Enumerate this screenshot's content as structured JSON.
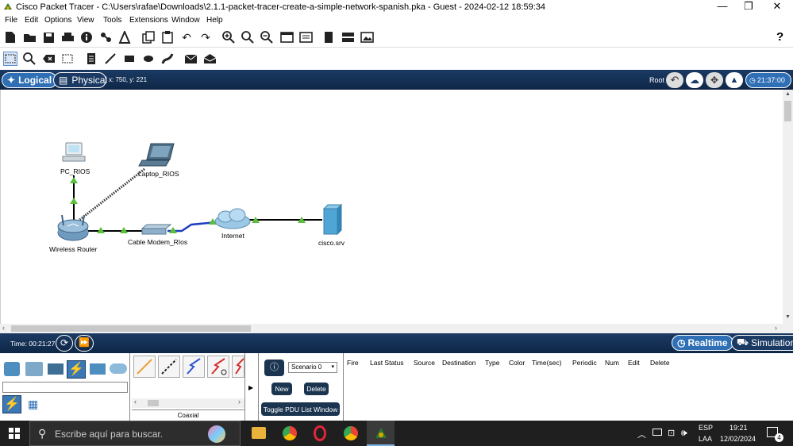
{
  "window": {
    "title": "Cisco Packet Tracer - C:\\Users\\rafae\\Downloads\\2.1.1-packet-tracer-create-a-simple-network-spanish.pka - Guest - 2024-02-12 18:59:34",
    "minimize": "—",
    "restore": "❐",
    "close": "✕"
  },
  "menu": [
    "File",
    "Edit",
    "Options",
    "View",
    "Tools",
    "Extensions",
    "Window",
    "Help"
  ],
  "toolbar": {
    "help": "?"
  },
  "viewbar": {
    "logical": "Logical",
    "physical": "Physical",
    "coords": "x: 750, y: 221",
    "root": "Root",
    "clock": "21:37:00"
  },
  "devices": {
    "pc": "PC_RIOS",
    "laptop": "Laptop_RIOS",
    "router": "Wireless Router",
    "modem": "Cable Modem_RIos",
    "internet": "Internet",
    "server": "cisco.srv"
  },
  "simbar": {
    "time": "Time: 00:21:27",
    "realtime": "Realtime",
    "simulation": "Simulation"
  },
  "device_panel": {
    "search_value": "",
    "conn_label": "Coaxial"
  },
  "scenario": {
    "selected": "Scenario 0",
    "new": "New",
    "delete": "Delete",
    "toggle": "Toggle PDU List Window"
  },
  "pdu_columns": [
    "Fire",
    "Last Status",
    "Source",
    "Destination",
    "Type",
    "Color",
    "Time(sec)",
    "Periodic",
    "Num",
    "Edit",
    "Delete"
  ],
  "taskbar": {
    "search_placeholder": "Escribe aquí para buscar.",
    "lang": "ESP",
    "layout": "LAA",
    "time": "19:21",
    "date": "12/02/2024",
    "notifications": "4"
  },
  "colors": {
    "accent_blue": "#1b3a63",
    "link_green": "#2ea043",
    "serial_blue": "#1f3fbf"
  }
}
